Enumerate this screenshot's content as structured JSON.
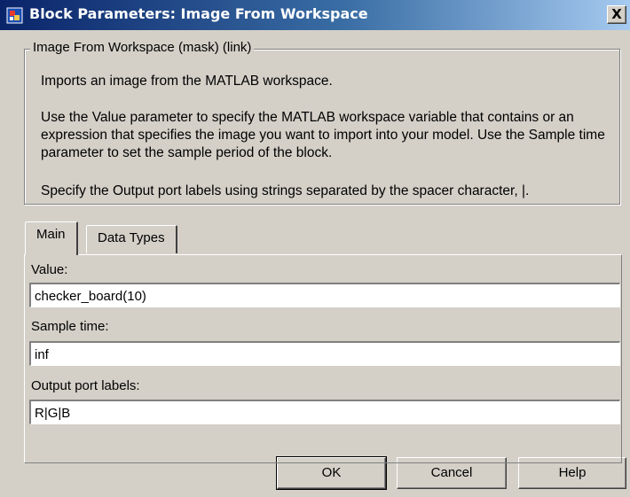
{
  "window": {
    "title": "Block Parameters: Image From Workspace",
    "close_label": "X"
  },
  "mask": {
    "title": "Image From Workspace (mask) (link)",
    "description_1": "Imports an image from the MATLAB workspace.",
    "description_2": "Use the Value parameter to specify the MATLAB workspace variable that contains or an expression that specifies the image you want to import into your model. Use the Sample time parameter to set the sample period of the block.",
    "description_3": "Specify the Output port labels using strings separated by the spacer character, |."
  },
  "tabs": [
    {
      "label": "Main",
      "selected": true
    },
    {
      "label": "Data Types",
      "selected": false
    }
  ],
  "fields": {
    "value_label": "Value:",
    "value": "checker_board(10)",
    "sample_time_label": "Sample time:",
    "sample_time": "inf",
    "output_labels_label": "Output port labels:",
    "output_labels": "R|G|B"
  },
  "buttons": {
    "ok": "OK",
    "cancel": "Cancel",
    "help": "Help"
  },
  "icons": {
    "app": "simulink-block-icon",
    "close": "close-icon"
  }
}
